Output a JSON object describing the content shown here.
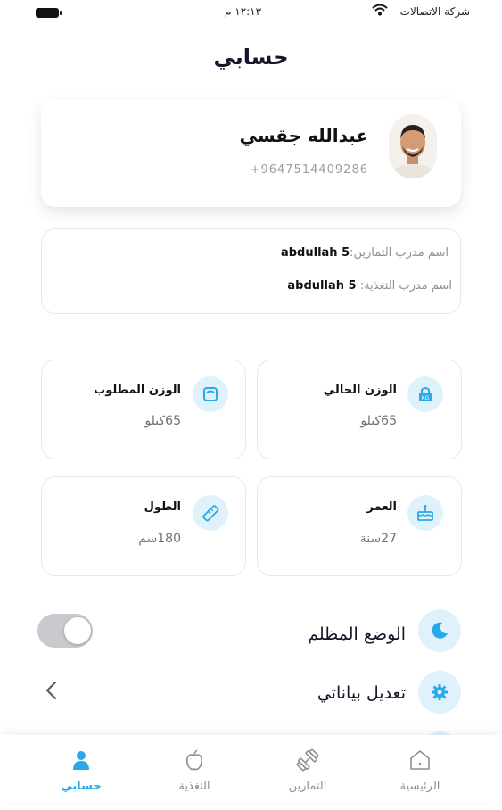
{
  "status_bar": {
    "carrier": "شركة الاتصالات",
    "time": "١٢:١٣ م"
  },
  "header": {
    "title": "حسابي"
  },
  "profile": {
    "name": "عبدالله جقسي",
    "phone": "+9647514409286"
  },
  "trainers": {
    "workout_label": "اسم مدرب التمارين:",
    "workout_value": "abdullah 5",
    "nutrition_label": "اسم مدرب التغذية:",
    "nutrition_value": "abdullah 5"
  },
  "stats": {
    "current_weight": {
      "title": "الوزن الحالي",
      "value": "65كيلو"
    },
    "target_weight": {
      "title": "الوزن المطلوب",
      "value": "65كيلو"
    },
    "age": {
      "title": "العمر",
      "value": "27سنة"
    },
    "height": {
      "title": "الطول",
      "value": "180سم"
    }
  },
  "settings": {
    "dark_mode_label": "الوضع المظلم",
    "dark_mode_on": false,
    "edit_data_label": "تعديل بياناتي"
  },
  "tabbar": {
    "home": "الرئيسية",
    "workouts": "التمارين",
    "nutrition": "التغذية",
    "account": "حسابي",
    "active": "account",
    "active_color": "#2aa9e8"
  }
}
